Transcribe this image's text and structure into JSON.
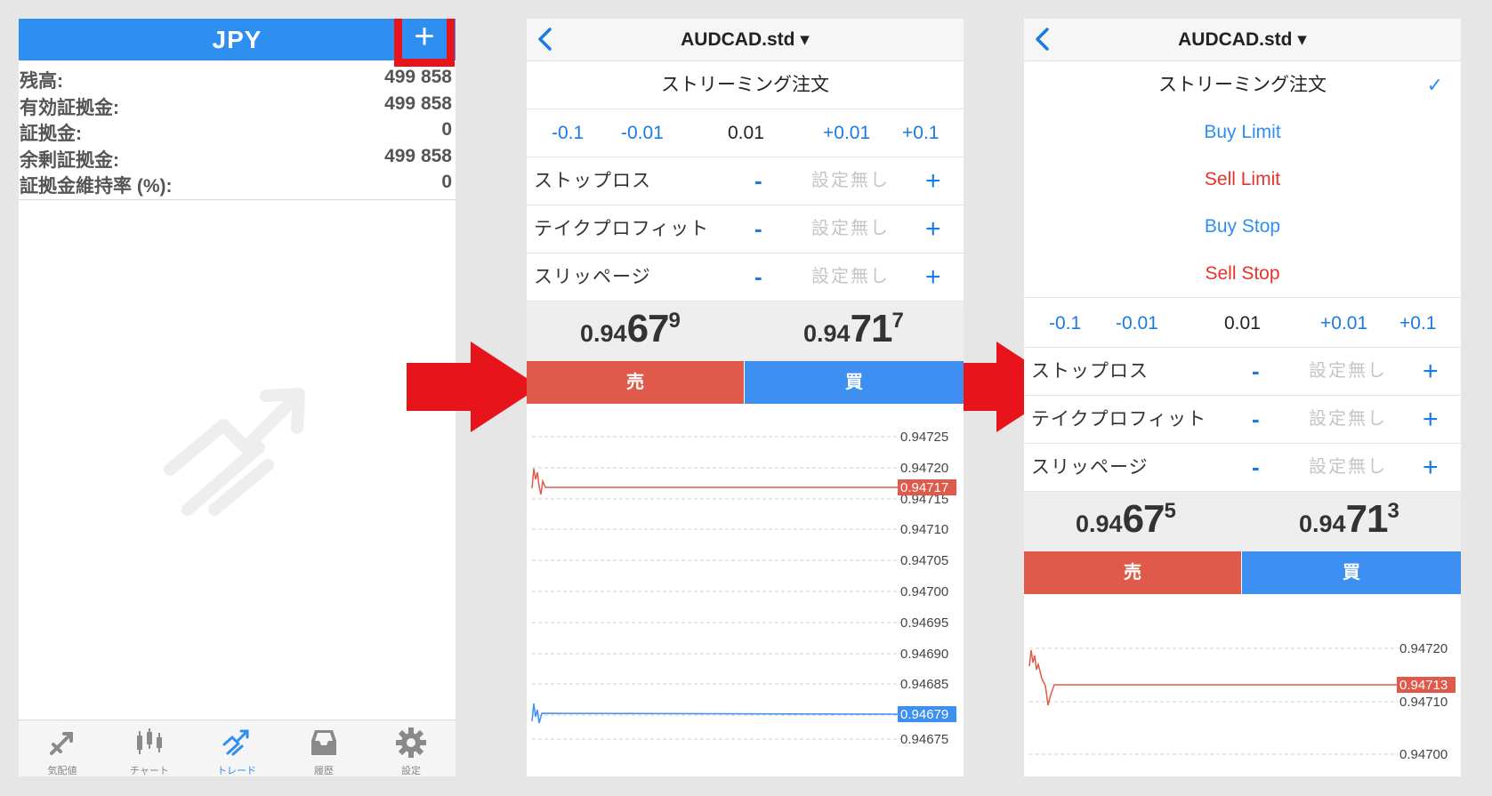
{
  "screen1": {
    "title": "JPY",
    "stats": [
      {
        "label": "残高:",
        "value": "499 858"
      },
      {
        "label": "有効証拠金:",
        "value": "499 858"
      },
      {
        "label": "証拠金:",
        "value": "0"
      },
      {
        "label": "余剰証拠金:",
        "value": "499 858"
      },
      {
        "label": "証拠金維持率 (%):",
        "value": "0"
      }
    ],
    "tabs": [
      {
        "label": "気配値",
        "icon": "quotes-icon"
      },
      {
        "label": "チャート",
        "icon": "chart-icon"
      },
      {
        "label": "トレード",
        "icon": "trade-icon",
        "active": true
      },
      {
        "label": "履歴",
        "icon": "history-icon"
      },
      {
        "label": "設定",
        "icon": "settings-gear-icon"
      }
    ],
    "highlight_color": "#e8141c",
    "accent_color": "#2f8ff0"
  },
  "screen2": {
    "title": "AUDCAD.std ▾",
    "order_type": "ストリーミング注文",
    "volume": {
      "minus_big": "-0.1",
      "minus_small": "-0.01",
      "current": "0.01",
      "plus_small": "+0.01",
      "plus_big": "+0.1"
    },
    "params": [
      {
        "label": "ストップロス",
        "minus": "-",
        "value": "設定無し",
        "plus": "+"
      },
      {
        "label": "テイクプロフィット",
        "minus": "-",
        "value": "設定無し",
        "plus": "+"
      },
      {
        "label": "スリッページ",
        "minus": "-",
        "value": "設定無し",
        "plus": "+"
      }
    ],
    "bid": {
      "prefix": "0.94",
      "big": "67",
      "sup": "9"
    },
    "ask": {
      "prefix": "0.94",
      "big": "71",
      "sup": "7"
    },
    "sell_label": "売",
    "buy_label": "買",
    "chart_levels": [
      "0.94725",
      "0.94720",
      "0.94715",
      "0.94710",
      "0.94705",
      "0.94700",
      "0.94695",
      "0.94690",
      "0.94685",
      "0.94675"
    ],
    "ask_tag": "0.94717",
    "bid_tag": "0.94679"
  },
  "screen3": {
    "title": "AUDCAD.std ▾",
    "order_types": [
      {
        "label": "ストリーミング注文",
        "selected": true,
        "color": "#222222"
      },
      {
        "label": "Buy Limit",
        "color": "#2f8ff0"
      },
      {
        "label": "Sell Limit",
        "color": "#e8322a"
      },
      {
        "label": "Buy Stop",
        "color": "#2f8ff0"
      },
      {
        "label": "Sell Stop",
        "color": "#e8322a"
      }
    ],
    "check_mark": "✓",
    "volume": {
      "minus_big": "-0.1",
      "minus_small": "-0.01",
      "current": "0.01",
      "plus_small": "+0.01",
      "plus_big": "+0.1"
    },
    "params": [
      {
        "label": "ストップロス",
        "minus": "-",
        "value": "設定無し",
        "plus": "+"
      },
      {
        "label": "テイクプロフィット",
        "minus": "-",
        "value": "設定無し",
        "plus": "+"
      },
      {
        "label": "スリッページ",
        "minus": "-",
        "value": "設定無し",
        "plus": "+"
      }
    ],
    "bid": {
      "prefix": "0.94",
      "big": "67",
      "sup": "5"
    },
    "ask": {
      "prefix": "0.94",
      "big": "71",
      "sup": "3"
    },
    "sell_label": "売",
    "buy_label": "買",
    "chart_levels": [
      "0.94720",
      "0.94710",
      "0.94700"
    ],
    "ask_tag": "0.94713"
  },
  "colors": {
    "sell": "#e05a4c",
    "buy": "#3e8ff2",
    "link": "#1a7be0",
    "arrow": "#e8141c"
  }
}
